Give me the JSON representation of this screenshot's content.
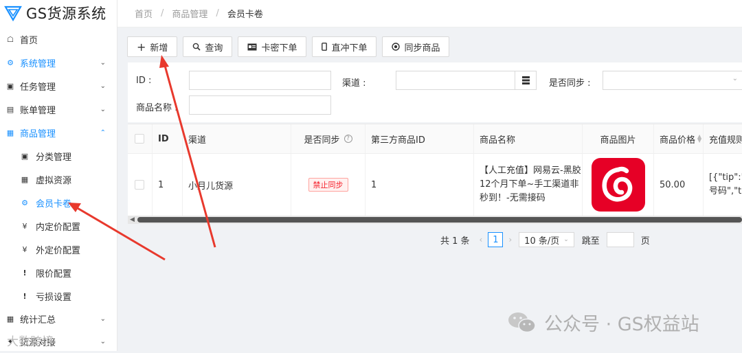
{
  "app": {
    "title": "GS货源系统"
  },
  "breadcrumb": [
    "首页",
    "商品管理",
    "会员卡卷"
  ],
  "sidebar": {
    "items": [
      {
        "label": "首页",
        "icon": "home-icon"
      },
      {
        "label": "系统管理",
        "icon": "gears-icon"
      },
      {
        "label": "任务管理",
        "icon": "cubes-icon"
      },
      {
        "label": "账单管理",
        "icon": "money-icon"
      },
      {
        "label": "商品管理",
        "icon": "calendar-icon"
      },
      {
        "label": "分类管理",
        "icon": "cubes-icon"
      },
      {
        "label": "虚拟资源",
        "icon": "calendar-icon"
      },
      {
        "label": "会员卡卷",
        "icon": "gear-outline-icon"
      },
      {
        "label": "内定价配置",
        "icon": "yen-icon"
      },
      {
        "label": "外定价配置",
        "icon": "yen-icon"
      },
      {
        "label": "限价配置",
        "icon": "exclamation-icon"
      },
      {
        "label": "亏损设置",
        "icon": "exclamation-icon"
      },
      {
        "label": "统计汇总",
        "icon": "table-icon"
      },
      {
        "label": "货源对接",
        "icon": "plug-icon"
      }
    ]
  },
  "toolbar": {
    "add": "新增",
    "query": "查询",
    "card_order": "卡密下单",
    "direct_order": "直冲下单",
    "sync": "同步商品"
  },
  "filter": {
    "id_label": "ID :",
    "channel_label": "渠道 :",
    "synced_label": "是否同步 :",
    "name_label": "商品名称 :"
  },
  "table": {
    "columns": [
      "ID",
      "渠道",
      "是否同步",
      "第三方商品ID",
      "商品名称",
      "商品图片",
      "商品价格",
      "充值规则"
    ],
    "rows": [
      {
        "id": "1",
        "channel": "小月儿货源",
        "sync": "禁止同步",
        "third_id": "1",
        "name_line1": "【人工充值】网易云-黑胶",
        "name_line2": "12个月下单~手工渠道非",
        "name_line3": "秒到！-无需接码",
        "price": "50.00",
        "rule_line1": "[{\"tip\":\"请",
        "rule_line2": "号码\",\"tit"
      }
    ]
  },
  "pagination": {
    "total": "共 1 条",
    "current": "1",
    "page_size": "10 条/页",
    "jump": "跳至",
    "page_unit": "页"
  },
  "watermark": {
    "wechat": "公众号 · GS权益站",
    "brand": "大数跨境"
  },
  "colors": {
    "accent": "#1890ff",
    "arrow": "#e8392d",
    "netease": "#e60026"
  }
}
